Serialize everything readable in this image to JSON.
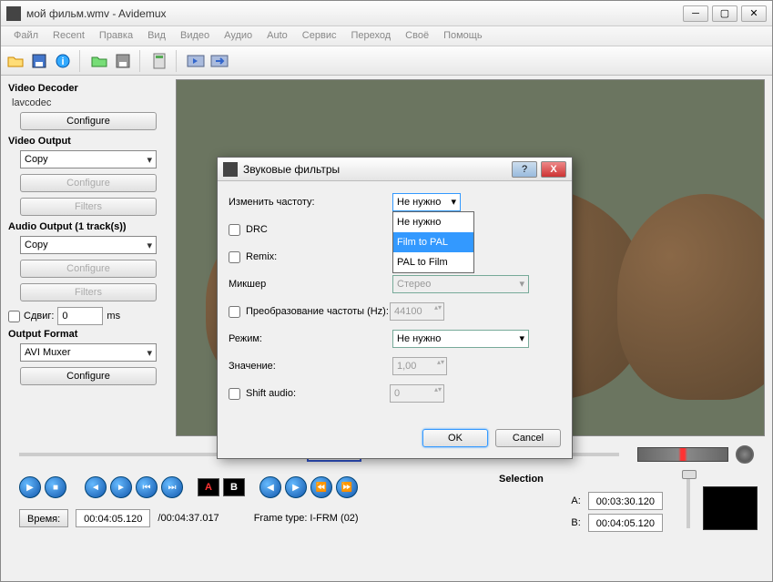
{
  "window": {
    "title": "мой фильм.wmv - Avidemux"
  },
  "menu": [
    "Файл",
    "Recent",
    "Правка",
    "Вид",
    "Видео",
    "Аудио",
    "Auto",
    "Сервис",
    "Переход",
    "Своё",
    "Помощь"
  ],
  "sidebar": {
    "decoder_h": "Video Decoder",
    "decoder_val": "lavcodec",
    "configure": "Configure",
    "vout_h": "Video Output",
    "vout_val": "Copy",
    "filters": "Filters",
    "aout_h": "Audio Output (1 track(s))",
    "aout_val": "Copy",
    "shift_lbl": "Сдвиг:",
    "shift_val": "0",
    "shift_unit": "ms",
    "fmt_h": "Output Format",
    "fmt_val": "AVI Muxer"
  },
  "dialog": {
    "title": "Звуковые фильтры",
    "freq_lbl": "Изменить частоту:",
    "freq_val": "Не нужно",
    "options": [
      "Не нужно",
      "Film to PAL",
      "PAL to Film"
    ],
    "drc": "DRC",
    "remix": "Remix:",
    "mixer": "Микшер",
    "mixer_val": "Стерео",
    "conv": "Преобразование частоты (Hz):",
    "conv_val": "44100",
    "mode": "Режим:",
    "mode_val": "Не нужно",
    "value_lbl": "Значение:",
    "value_val": "1,00",
    "shift": "Shift audio:",
    "shift_val": "0",
    "ok": "OK",
    "cancel": "Cancel"
  },
  "selection": {
    "h": "Selection",
    "a_lbl": "A:",
    "a_val": "00:03:30.120",
    "b_lbl": "B:",
    "b_val": "00:04:05.120"
  },
  "bottom": {
    "time_lbl": "Время:",
    "time_val": "00:04:05.120",
    "total": "/00:04:37.017",
    "ftype": "Frame type: I-FRM (02)"
  }
}
